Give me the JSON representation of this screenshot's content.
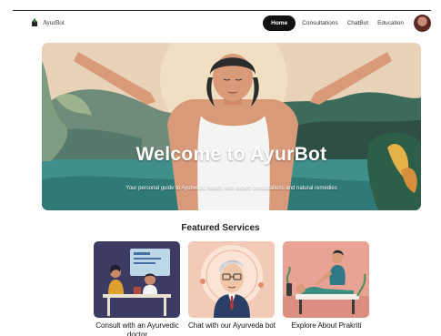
{
  "brand": {
    "name": "AyurBot",
    "icon": "leaf-logo-icon"
  },
  "nav": {
    "links": [
      {
        "label": "Home",
        "active": true
      },
      {
        "label": "Consultations"
      },
      {
        "label": "ChatBot"
      },
      {
        "label": "Education"
      }
    ],
    "avatar": "user-avatar"
  },
  "hero": {
    "title": "Welcome to AyurBot",
    "subtitle": "Your personal guide to Ayurvedic health, with expert consultations and natural remedies"
  },
  "featured": {
    "title": "Featured Services",
    "cards": [
      {
        "label": "Consult with an Ayurvedic doctor"
      },
      {
        "label": "Chat with our Ayurveda bot"
      },
      {
        "label": "Explore About Prakriti"
      }
    ]
  },
  "colors": {
    "hero_bg": "#e9d3b8",
    "lake": "#3f8f8a",
    "card1_bg": "#3b3b63",
    "card2_bg": "#f3c9b8",
    "card3_bg": "#e9a395"
  }
}
